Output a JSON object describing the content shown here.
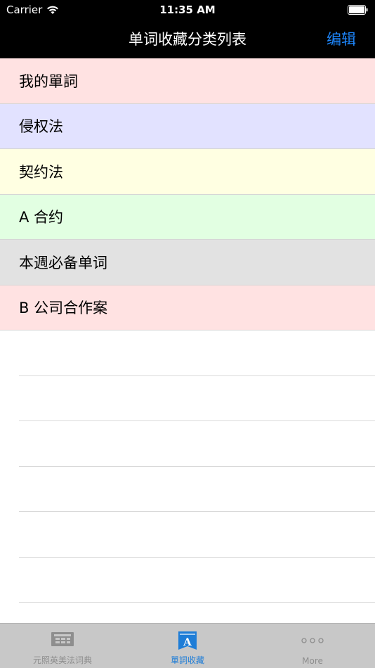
{
  "status_bar": {
    "carrier": "Carrier",
    "time": "11:35 AM"
  },
  "nav": {
    "title": "单词收藏分类列表",
    "edit_label": "编辑"
  },
  "categories": [
    {
      "label": "我的單詞",
      "color": "#ffe2e2"
    },
    {
      "label": "侵权法",
      "color": "#e2e2ff"
    },
    {
      "label": "契约法",
      "color": "#ffffe2"
    },
    {
      "label": "A 合约",
      "color": "#e2ffe2"
    },
    {
      "label": "本週必备单词",
      "color": "#e2e2e2"
    },
    {
      "label": "B 公司合作案",
      "color": "#ffe2e2"
    }
  ],
  "tabs": [
    {
      "label": "元照英美法词典",
      "icon": "dictionary-icon",
      "active": false
    },
    {
      "label": "單詞收藏",
      "icon": "bookmark-icon",
      "active": true
    },
    {
      "label": "More",
      "icon": "more-icon",
      "active": false
    }
  ],
  "colors": {
    "accent": "#1e88ff",
    "tab_active": "#1e7dd7",
    "tab_inactive": "#8e8e8e"
  }
}
